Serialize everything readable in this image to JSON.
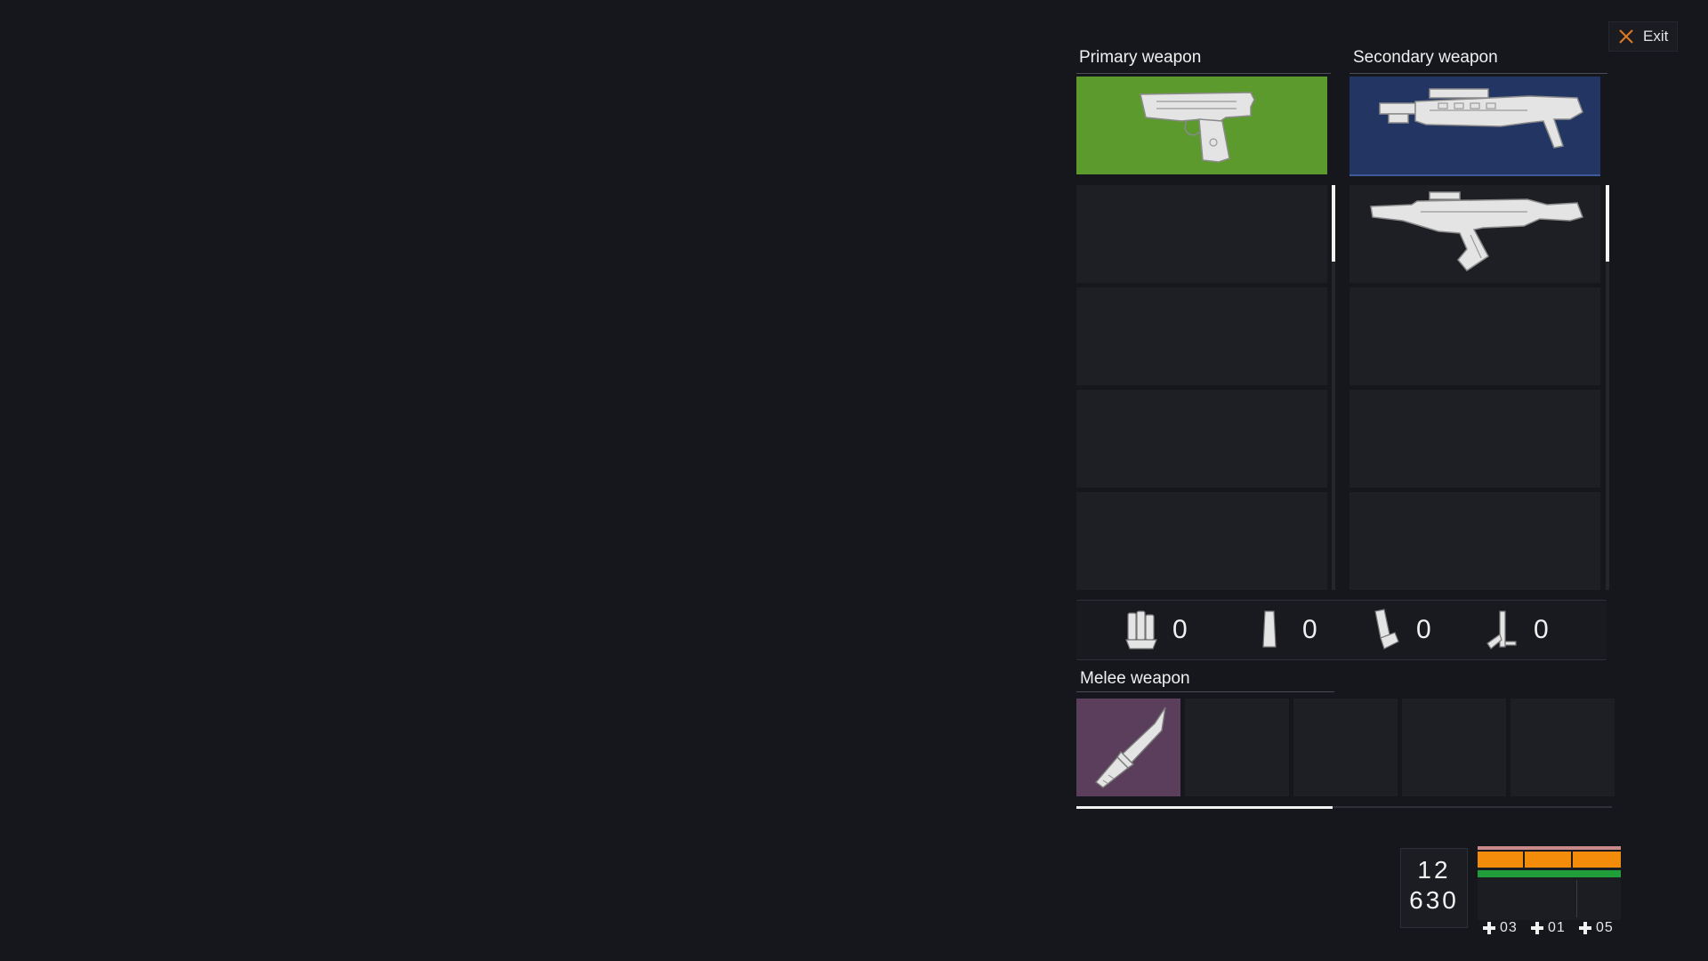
{
  "exit": {
    "label": "Exit",
    "icon": "close-icon",
    "icon_color": "#e07a1f"
  },
  "primary": {
    "title": "Primary weapon",
    "equipped": {
      "icon": "pistol-icon",
      "color": "#5c9a2e"
    },
    "slots": [
      "",
      "",
      "",
      ""
    ]
  },
  "secondary": {
    "title": "Secondary weapon",
    "equipped": {
      "icon": "shotgun-icon",
      "color": "#233663"
    },
    "slots": [
      {
        "icon": "assault-rifle-icon"
      },
      {
        "icon": ""
      },
      {
        "icon": ""
      },
      {
        "icon": ""
      }
    ]
  },
  "ammo": [
    {
      "icon": "shotgun-shells-icon",
      "count": "0"
    },
    {
      "icon": "pistol-magazine-icon",
      "count": "0"
    },
    {
      "icon": "rifle-magazine-icon",
      "count": "0"
    },
    {
      "icon": "grenade-launcher-icon",
      "count": "0"
    }
  ],
  "melee": {
    "title": "Melee weapon",
    "equipped": {
      "icon": "knife-icon",
      "color": "#5a3e5c"
    }
  },
  "hud": {
    "ammo_clip": "12",
    "ammo_total": "630",
    "bars": {
      "health_color": "#f28c0a",
      "stamina_color": "#1f9e3a",
      "top_color": "#c98a8a"
    },
    "heals": [
      {
        "icon": "plus-icon",
        "count": "03"
      },
      {
        "icon": "plus-icon",
        "count": "01"
      },
      {
        "icon": "plus-icon",
        "count": "05"
      }
    ]
  }
}
